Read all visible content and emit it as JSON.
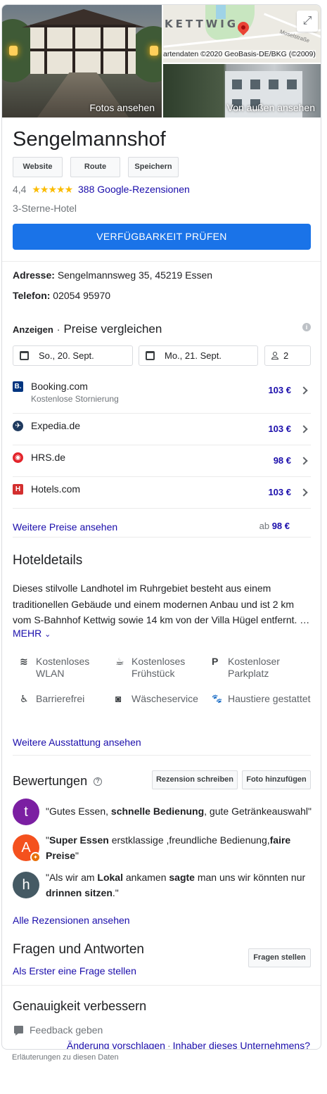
{
  "photos": {
    "main_label": "Fotos ansehen",
    "outside_label": "Von außen ansehen",
    "map_town": "KETTWIG",
    "map_street": "Moselstraße",
    "map_copyright": "artendaten ©2020 GeoBasis-DE/BKG (©2009)"
  },
  "header": {
    "title": "Sengelmannshof",
    "buttons": {
      "website": "Website",
      "route": "Route",
      "save": "Speichern"
    },
    "rating": "4,4",
    "stars": "★★★★★",
    "reviews_link": "388 Google-Rezensionen",
    "category": "3-Sterne-Hotel",
    "availability_button": "VERFÜGBARKEIT PRÜFEN"
  },
  "contact": {
    "address_label": "Adresse:",
    "address": "Sengelmannsweg 35, 45219 Essen",
    "phone_label": "Telefon:",
    "phone": "02054 95970"
  },
  "prices": {
    "ads_label": "Anzeigen",
    "separator": "·",
    "heading": "Preise vergleichen",
    "info_icon": "i",
    "checkin": "So., 20. Sept.",
    "checkout": "Mo., 21. Sept.",
    "guests": "2",
    "providers": [
      {
        "name": "Booking.com",
        "subtitle": "Kostenlose Stornierung",
        "price": "103 €",
        "logo": "B.",
        "color": "#003580"
      },
      {
        "name": "Expedia.de",
        "subtitle": "",
        "price": "103 €",
        "logo": "✈",
        "color": "#1f3a5f"
      },
      {
        "name": "HRS.de",
        "subtitle": "",
        "price": "98 €",
        "logo": "◉",
        "color": "#e3242b"
      },
      {
        "name": "Hotels.com",
        "subtitle": "",
        "price": "103 €",
        "logo": "H",
        "color": "#d32f2f"
      }
    ],
    "more_prices": "Weitere Preise ansehen",
    "from_label": "ab",
    "from_price": "98 €"
  },
  "details": {
    "heading": "Hoteldetails",
    "description": "Dieses stilvolle Landhotel im Ruhrgebiet besteht aus einem traditionellen Gebäude und einem modernen Anbau und ist 2 km vom S-Bahnhof Kettwig sowie 14 km von der Villa Hügel entfernt. …",
    "more": "MEHR",
    "amenities": [
      {
        "label": "Kostenloses WLAN",
        "icon": "wifi-icon",
        "glyph": "≋"
      },
      {
        "label": "Kostenloses Frühstück",
        "icon": "coffee-icon",
        "glyph": "☕"
      },
      {
        "label": "Kostenloser Parkplatz",
        "icon": "parking-icon",
        "glyph": "P"
      },
      {
        "label": "Barrierefrei",
        "icon": "accessible-icon",
        "glyph": "♿"
      },
      {
        "label": "Wäscheservice",
        "icon": "laundry-icon",
        "glyph": "◙"
      },
      {
        "label": "Haustiere gestattet",
        "icon": "paw-icon",
        "glyph": "🐾"
      }
    ],
    "more_amenities": "Weitere Ausstattung ansehen"
  },
  "reviews": {
    "heading": "Bewertungen",
    "write_button": "Rezension schreiben",
    "photo_button": "Foto hinzufügen",
    "items": [
      {
        "initial": "t",
        "color": "#7b1fa2",
        "html": "\"Gutes Essen, <b>schnelle Bedienung</b>, gute Getränkeauswahl\""
      },
      {
        "initial": "A",
        "color": "#f4511e",
        "html": "\"<b>Super Essen</b> erstklassige ,freundliche Bedienung,<b>faire Preise</b>\""
      },
      {
        "initial": "h",
        "color": "#455a64",
        "html": "\"Als wir am <b>Lokal</b> ankamen <b>sagte</b> man uns wir könnten nur <b>drinnen sitzen</b>.\""
      }
    ],
    "all_reviews": "Alle Rezensionen ansehen"
  },
  "qa": {
    "heading": "Fragen und Antworten",
    "first_question": "Als Erster eine Frage stellen",
    "ask_button": "Fragen stellen"
  },
  "accuracy": {
    "heading": "Genauigkeit verbessern",
    "feedback": "Feedback geben",
    "suggest_change": "Änderung vorschlagen",
    "separator": "·",
    "owner": "Inhaber dieses Unternehmens?"
  },
  "footer": {
    "note": "Erläuterungen zu diesen Daten"
  }
}
